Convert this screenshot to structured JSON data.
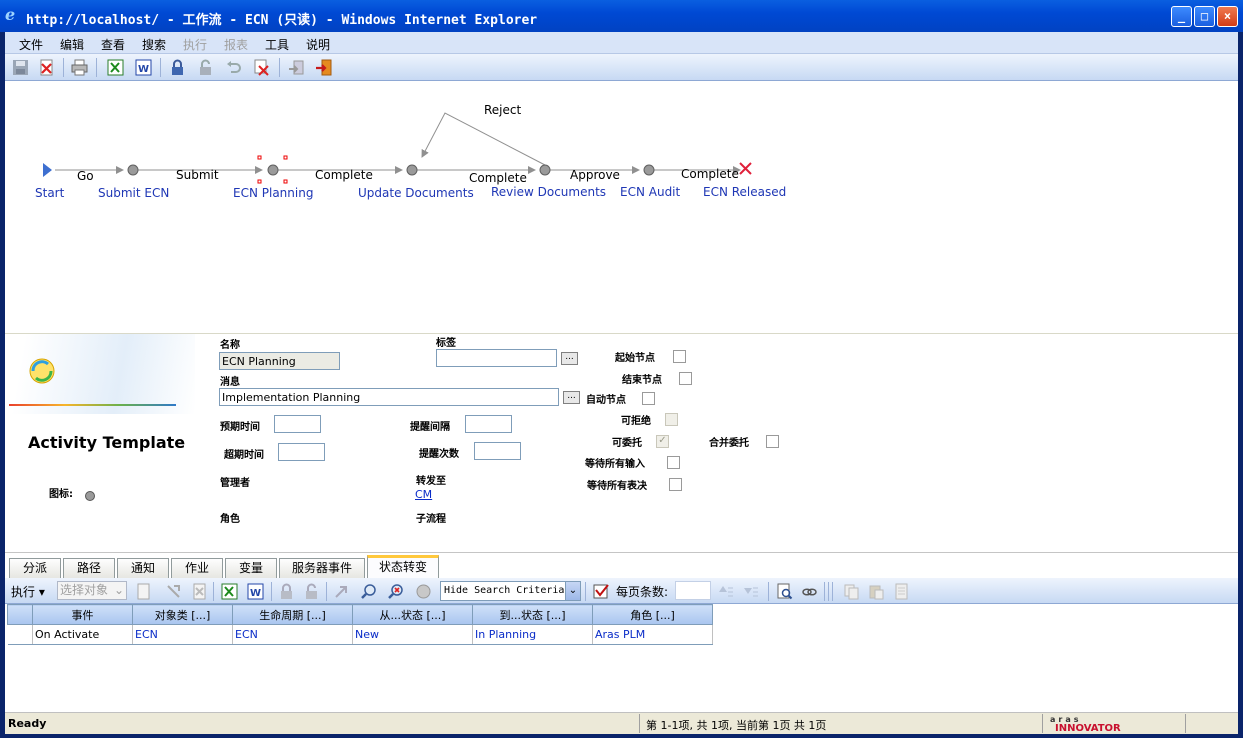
{
  "window": {
    "title": "http://localhost/ - 工作流 - ECN (只读) - Windows Internet Explorer",
    "buttons": [
      "_",
      "□",
      "×"
    ]
  },
  "menu": [
    "文件",
    "编辑",
    "查看",
    "搜索",
    "执行",
    "报表",
    "工具",
    "说明"
  ],
  "menu_disabled": [
    "执行",
    "报表"
  ],
  "toolbar_icons": [
    "save-icon",
    "close-doc-icon",
    "print-icon",
    "excel-icon",
    "word-icon",
    "lock-icon",
    "unlock-icon",
    "undo-icon",
    "delete-icon",
    "promote-icon",
    "exit-icon"
  ],
  "workflow": {
    "nodes": [
      {
        "id": "start",
        "label": "Start",
        "shape": "triangle"
      },
      {
        "id": "submit-ecn",
        "label": "Submit ECN",
        "shape": "circle"
      },
      {
        "id": "ecn-planning",
        "label": "ECN Planning",
        "shape": "circle",
        "selected": true
      },
      {
        "id": "update-documents",
        "label": "Update Documents",
        "shape": "circle"
      },
      {
        "id": "review-documents",
        "label": "Review Documents",
        "shape": "circle"
      },
      {
        "id": "ecn-audit",
        "label": "ECN Audit",
        "shape": "circle"
      },
      {
        "id": "ecn-released",
        "label": "ECN Released",
        "shape": "x"
      }
    ],
    "paths": [
      "Go",
      "Submit",
      "Complete",
      "Complete",
      "Approve",
      "Complete",
      "Reject"
    ]
  },
  "activity": {
    "template_title": "Activity Template",
    "name_label": "名称",
    "name_value": "ECN Planning",
    "tag_label": "标签",
    "tag_value": "",
    "message_label": "消息",
    "message_value": "Implementation Planning",
    "expected_time_label": "预期时间",
    "overdue_time_label": "超期时间",
    "reminder_interval_label": "提醒间隔",
    "reminder_count_label": "提醒次数",
    "manager_label": "管理者",
    "role_label": "角色",
    "escalate_to_label": "转发至",
    "escalate_to_value": "CM",
    "subflow_label": "子流程",
    "icon_label": "图标:",
    "start_node_label": "起始节点",
    "end_node_label": "结束节点",
    "auto_node_label": "自动节点",
    "can_refuse_label": "可拒绝",
    "can_delegate_label": "可委托",
    "merge_delegate_label": "合并委托",
    "wait_all_inputs_label": "等待所有输入",
    "wait_all_votes_label": "等待所有表决",
    "can_delegate_checked": true
  },
  "tabs": [
    "分派",
    "路径",
    "通知",
    "作业",
    "变量",
    "服务器事件",
    "状态转变"
  ],
  "active_tab": "状态转变",
  "grid_toolbar": {
    "execute_label": "执行",
    "select_object_placeholder": "选择对象",
    "search_mode": "Hide Search Criteria",
    "page_size_label": "每页条数:"
  },
  "grid": {
    "columns": [
      "事件",
      "对象类 [...]",
      "生命周期 [...]",
      "从...状态 [...]",
      "到...状态 [...]",
      "角色 [...]"
    ],
    "rows": [
      [
        "On Activate",
        "ECN",
        "ECN",
        "New",
        "In Planning",
        "Aras PLM"
      ]
    ]
  },
  "status": {
    "left": "Ready",
    "middle": "第 1-1项, 共 1项, 当前第 1页 共 1页",
    "logo": "aras INNOVATOR"
  }
}
